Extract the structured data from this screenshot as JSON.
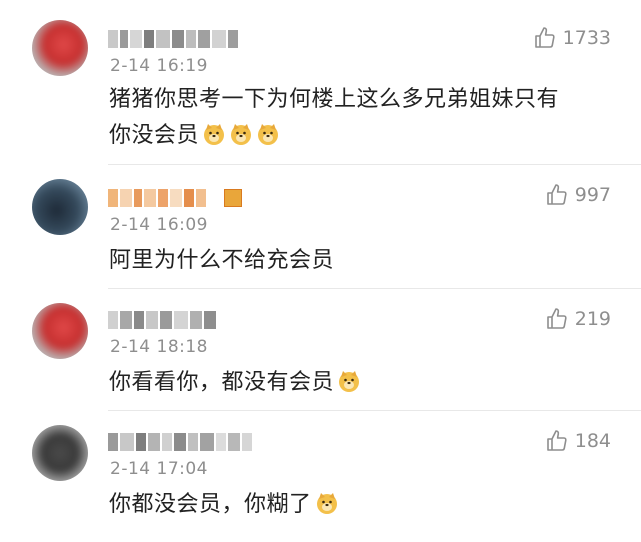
{
  "comments": [
    {
      "date": "2-14",
      "time": "16:19",
      "text_line1": "猪猪你思考一下为何楼上这么多兄弟姐妹只有",
      "text_line2": "你没会员",
      "emojis": [
        "doge-emoji",
        "doge-emoji",
        "doge-emoji"
      ],
      "likes": "1733"
    },
    {
      "date": "2-14",
      "time": "16:09",
      "text_line1": "阿里为什么不给充会员",
      "emojis": [],
      "likes": "997"
    },
    {
      "date": "2-14",
      "time": "18:18",
      "text_line1": "你看看你，都没有会员",
      "emojis": [
        "doge-emoji"
      ],
      "likes": "219"
    },
    {
      "date": "2-14",
      "time": "17:04",
      "text_line1": "你都没会员，你糊了",
      "emojis": [
        "doge-emoji"
      ],
      "likes": "184"
    }
  ],
  "colors": {
    "text": "#222222",
    "meta": "#8e8e8e",
    "divider": "#e8e8e8",
    "doge": "#f3c04a"
  },
  "icons": {
    "like": "thumbs-up-icon",
    "emoji": "doge-emoji"
  }
}
